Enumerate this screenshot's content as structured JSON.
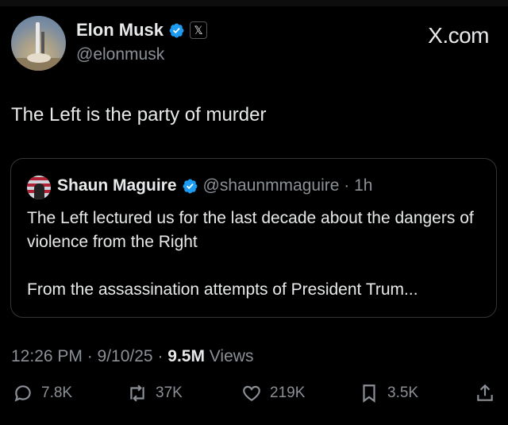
{
  "author": {
    "name": "Elon Musk",
    "handle": "@elonmusk",
    "verified_color": "#1d9bf0"
  },
  "brand": "X.com",
  "tweet": {
    "text": "The Left is the party of murder"
  },
  "quote": {
    "name": "Shaun Maguire",
    "handle_time": "@shaunmmaguire · 1h",
    "lines": [
      "The Left lectured us for the last decade about the dangers of violence from the Right",
      "From the assassination attempts of President Trum..."
    ]
  },
  "meta": {
    "time_date": "12:26 PM · 9/10/25 · ",
    "views_count": "9.5M",
    "views_label": " Views"
  },
  "actions": {
    "replies": "7.8K",
    "reposts": "37K",
    "likes": "219K",
    "bookmarks": "3.5K"
  },
  "icons": [
    "verified-badge-icon",
    "x-logo-icon",
    "reply-icon",
    "repost-icon",
    "like-icon",
    "bookmark-icon",
    "share-icon"
  ]
}
